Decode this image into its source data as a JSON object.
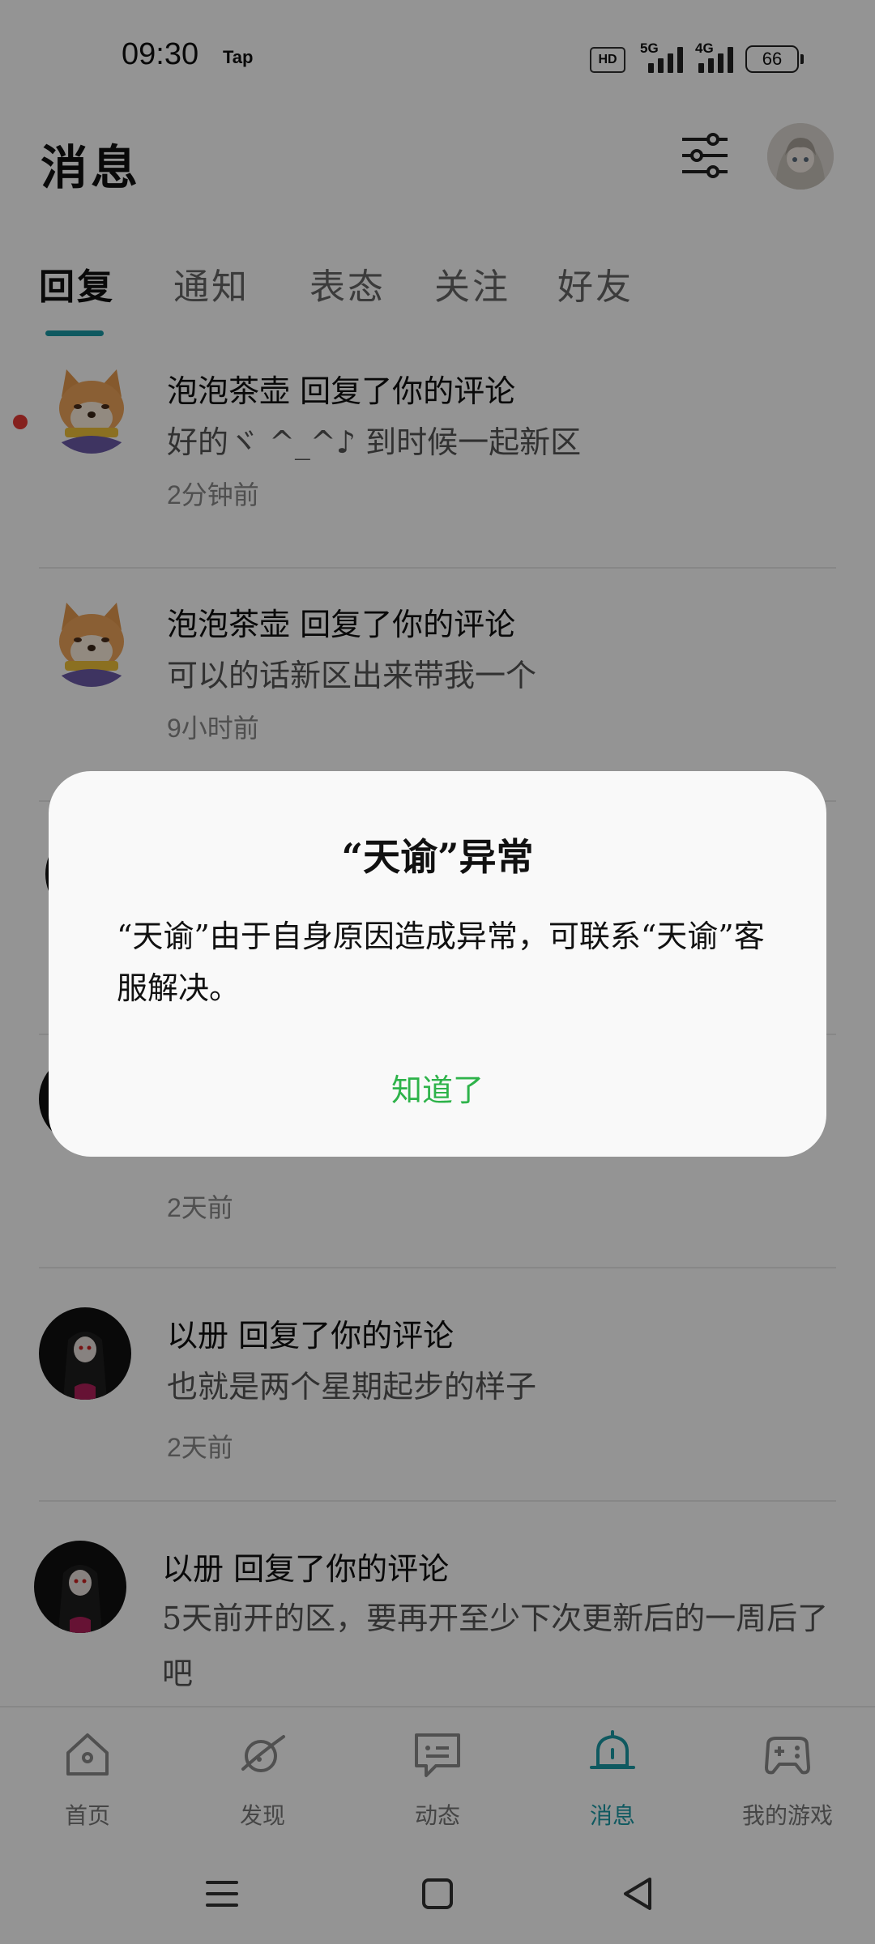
{
  "status_bar": {
    "time": "09:30",
    "carrier_app": "Tap",
    "hd": "HD",
    "net1": "5G",
    "net2": "4G",
    "battery": "66"
  },
  "header": {
    "title": "消息",
    "filter_icon": "sliders-icon",
    "avatar_icon": "user-avatar"
  },
  "tabs": [
    {
      "label": "回复",
      "active": true
    },
    {
      "label": "通知",
      "active": false
    },
    {
      "label": "表态",
      "active": false
    },
    {
      "label": "关注",
      "active": false
    },
    {
      "label": "好友",
      "active": false
    }
  ],
  "messages": [
    {
      "title": "泡泡茶壶 回复了你的评论",
      "body": "好的ヾ ^_^♪ 到时候一起新区",
      "time": "2分钟前",
      "unread": true,
      "avatar": "shiba-avatar"
    },
    {
      "title": "泡泡茶壶 回复了你的评论",
      "body": "可以的话新区出来带我一个",
      "time": "9小时前",
      "unread": false,
      "avatar": "shiba-avatar"
    },
    {
      "title": "",
      "body": "",
      "time": "",
      "unread": false,
      "avatar": "dark-girl-avatar"
    },
    {
      "title": "",
      "body": "",
      "time": "2天前",
      "unread": false,
      "avatar": "dark-girl-avatar"
    },
    {
      "title": "以册 回复了你的评论",
      "body": "也就是两个星期起步的样子",
      "time": "2天前",
      "unread": false,
      "avatar": "dark-girl-avatar"
    },
    {
      "title": "以册 回复了你的评论",
      "body": "5天前开的区，要再开至少下次更新后的一周后了吧",
      "time": "",
      "unread": false,
      "avatar": "dark-girl-avatar"
    }
  ],
  "bottom_nav": [
    {
      "label": "首页",
      "icon": "home-icon",
      "active": false
    },
    {
      "label": "发现",
      "icon": "planet-icon",
      "active": false
    },
    {
      "label": "动态",
      "icon": "chat-icon",
      "active": false
    },
    {
      "label": "消息",
      "icon": "bell-icon",
      "active": true
    },
    {
      "label": "我的游戏",
      "icon": "gamepad-icon",
      "active": false
    }
  ],
  "system_nav": [
    "menu-icon",
    "home-square-icon",
    "back-triangle-icon"
  ],
  "dialog": {
    "title": "“天谕”异常",
    "message": "“天谕”由于自身原因造成异常，可联系“天谕”客服解决。",
    "ok_label": "知道了"
  },
  "colors": {
    "accent": "#1b9aa5",
    "ok_green": "#2eb34a",
    "unread_red": "#e53935"
  }
}
